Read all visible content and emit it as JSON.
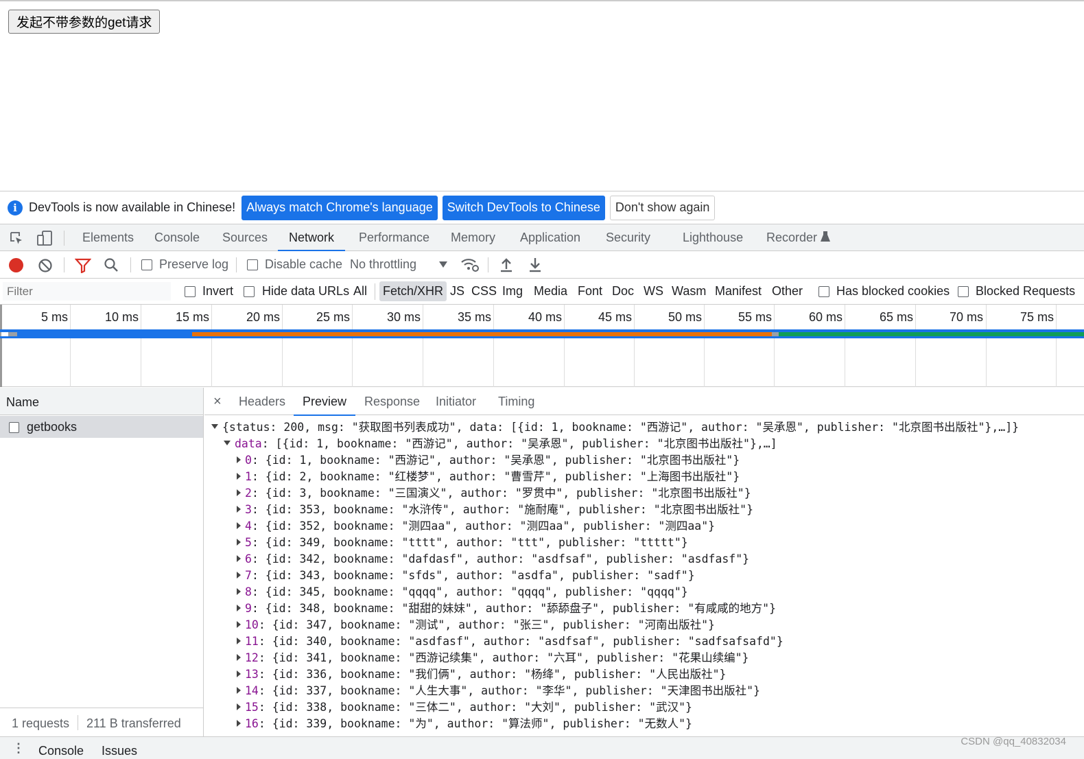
{
  "page": {
    "button_label": "发起不带参数的get请求"
  },
  "infobar": {
    "icon": "info-icon",
    "message": "DevTools is now available in Chinese!",
    "btn_match": "Always match Chrome's language",
    "btn_switch": "Switch DevTools to Chinese",
    "btn_dismiss": "Don't show again"
  },
  "tabs": [
    "Elements",
    "Console",
    "Sources",
    "Network",
    "Performance",
    "Memory",
    "Application",
    "Security",
    "Lighthouse",
    "Recorder"
  ],
  "active_tab": "Network",
  "toolbar": {
    "preserve_log": "Preserve log",
    "disable_cache": "Disable cache",
    "throttling": "No throttling"
  },
  "filterbar": {
    "placeholder": "Filter",
    "invert": "Invert",
    "hide_data_urls": "Hide data URLs",
    "types": [
      "All",
      "Fetch/XHR",
      "JS",
      "CSS",
      "Img",
      "Media",
      "Font",
      "Doc",
      "WS",
      "Wasm",
      "Manifest",
      "Other"
    ],
    "active_type": "Fetch/XHR",
    "has_blocked_cookies": "Has blocked cookies",
    "blocked_requests": "Blocked Requests"
  },
  "timeline": {
    "ticks": [
      "5 ms",
      "10 ms",
      "15 ms",
      "20 ms",
      "25 ms",
      "30 ms",
      "35 ms",
      "40 ms",
      "45 ms",
      "50 ms",
      "55 ms",
      "60 ms",
      "65 ms",
      "70 ms",
      "75 ms"
    ]
  },
  "requests": {
    "header": "Name",
    "items": [
      "getbooks"
    ],
    "summary_requests": "1 requests",
    "summary_transferred": "211 B transferred"
  },
  "detail": {
    "close": "×",
    "tabs": [
      "Headers",
      "Preview",
      "Response",
      "Initiator",
      "Timing"
    ],
    "active_tab": "Preview"
  },
  "preview": {
    "root": "{status: 200, msg: \"获取图书列表成功\", data: [{id: 1, bookname: \"西游记\", author: \"吴承恩\", publisher: \"北京图书出版社\"},…]}",
    "data_key": "data",
    "data_summary": ": [{id: 1, bookname: \"西游记\", author: \"吴承恩\", publisher: \"北京图书出版社\"},…]",
    "items": [
      {
        "idx": "0",
        "text": ": {id: 1, bookname: \"西游记\", author: \"吴承恩\", publisher: \"北京图书出版社\"}"
      },
      {
        "idx": "1",
        "text": ": {id: 2, bookname: \"红楼梦\", author: \"曹雪芹\", publisher: \"上海图书出版社\"}"
      },
      {
        "idx": "2",
        "text": ": {id: 3, bookname: \"三国演义\", author: \"罗贯中\", publisher: \"北京图书出版社\"}"
      },
      {
        "idx": "3",
        "text": ": {id: 353, bookname: \"水浒传\", author: \"施耐庵\", publisher: \"北京图书出版社\"}"
      },
      {
        "idx": "4",
        "text": ": {id: 352, bookname: \"测四aa\", author: \"测四aa\", publisher: \"测四aa\"}"
      },
      {
        "idx": "5",
        "text": ": {id: 349, bookname: \"tttt\", author: \"ttt\", publisher: \"ttttt\"}"
      },
      {
        "idx": "6",
        "text": ": {id: 342, bookname: \"dafdasf\", author: \"asdfsaf\", publisher: \"asdfasf\"}"
      },
      {
        "idx": "7",
        "text": ": {id: 343, bookname: \"sfds\", author: \"asdfa\", publisher: \"sadf\"}"
      },
      {
        "idx": "8",
        "text": ": {id: 345, bookname: \"qqqq\", author: \"qqqq\", publisher: \"qqqq\"}"
      },
      {
        "idx": "9",
        "text": ": {id: 348, bookname: \"甜甜的妹妹\", author: \"舔舔盘子\", publisher: \"有咸咸的地方\"}"
      },
      {
        "idx": "10",
        "text": ": {id: 347, bookname: \"测试\", author: \"张三\", publisher: \"河南出版社\"}"
      },
      {
        "idx": "11",
        "text": ": {id: 340, bookname: \"asdfasf\", author: \"asdfsaf\", publisher: \"sadfsafsafd\"}"
      },
      {
        "idx": "12",
        "text": ": {id: 341, bookname: \"西游记续集\", author: \"六耳\", publisher: \"花果山续编\"}"
      },
      {
        "idx": "13",
        "text": ": {id: 336, bookname: \"我们俩\", author: \"杨绛\", publisher: \"人民出版社\"}"
      },
      {
        "idx": "14",
        "text": ": {id: 337, bookname: \"人生大事\", author: \"李华\", publisher: \"天津图书出版社\"}"
      },
      {
        "idx": "15",
        "text": ": {id: 338, bookname: \"三体二\", author: \"大刘\", publisher: \"武汉\"}"
      },
      {
        "idx": "16",
        "text": ": {id: 339, bookname: \"为\", author: \"算法师\", publisher: \"无数人\"}"
      }
    ]
  },
  "bottombar": {
    "tabs": [
      "Console",
      "Issues"
    ]
  },
  "watermark": "CSDN @qq_40832034",
  "colors": {
    "accent": "#1a73e8",
    "record": "#d93025",
    "key": "#881391",
    "waterfall_blue": "#1a73e8",
    "waterfall_orange": "#e8710a",
    "waterfall_green": "#0f9d58"
  }
}
